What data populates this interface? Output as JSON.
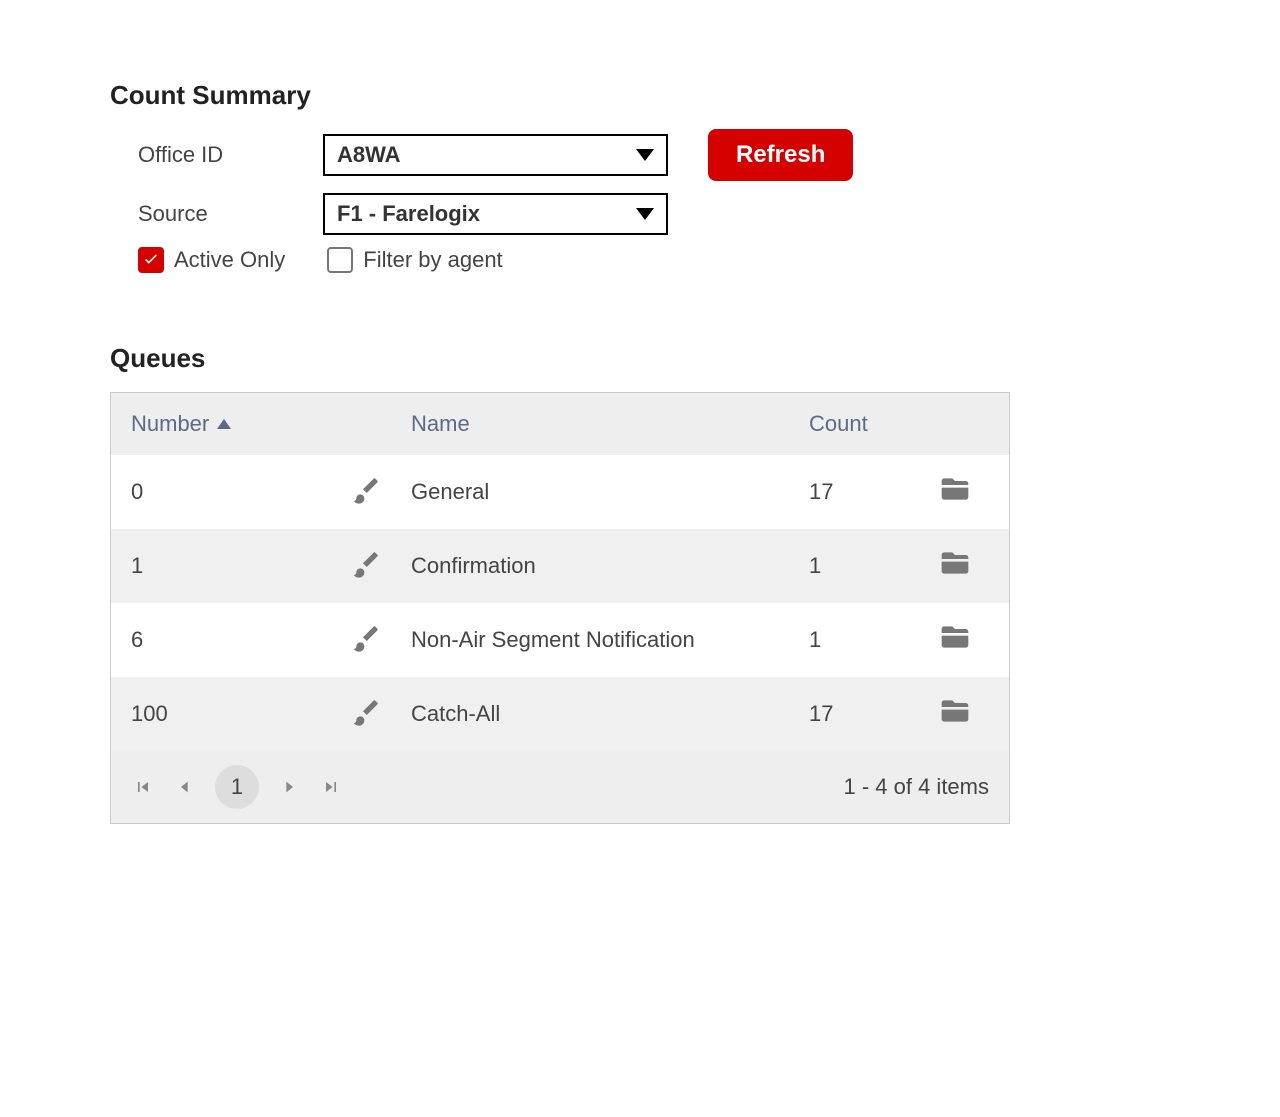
{
  "summary": {
    "title": "Count Summary",
    "officeIdLabel": "Office ID",
    "officeIdValue": "A8WA",
    "sourceLabel": "Source",
    "sourceValue": "F1 - Farelogix",
    "refreshLabel": "Refresh",
    "activeOnlyLabel": "Active Only",
    "filterByAgentLabel": "Filter by agent"
  },
  "queues": {
    "title": "Queues",
    "columns": {
      "number": "Number",
      "name": "Name",
      "count": "Count"
    },
    "rows": [
      {
        "number": "0",
        "name": "General",
        "count": "17"
      },
      {
        "number": "1",
        "name": "Confirmation",
        "count": "1"
      },
      {
        "number": "6",
        "name": "Non-Air Segment Notification",
        "count": "1"
      },
      {
        "number": "100",
        "name": "Catch-All",
        "count": "17"
      }
    ],
    "pager": {
      "currentPage": "1",
      "info": "1 - 4 of 4 items"
    }
  }
}
